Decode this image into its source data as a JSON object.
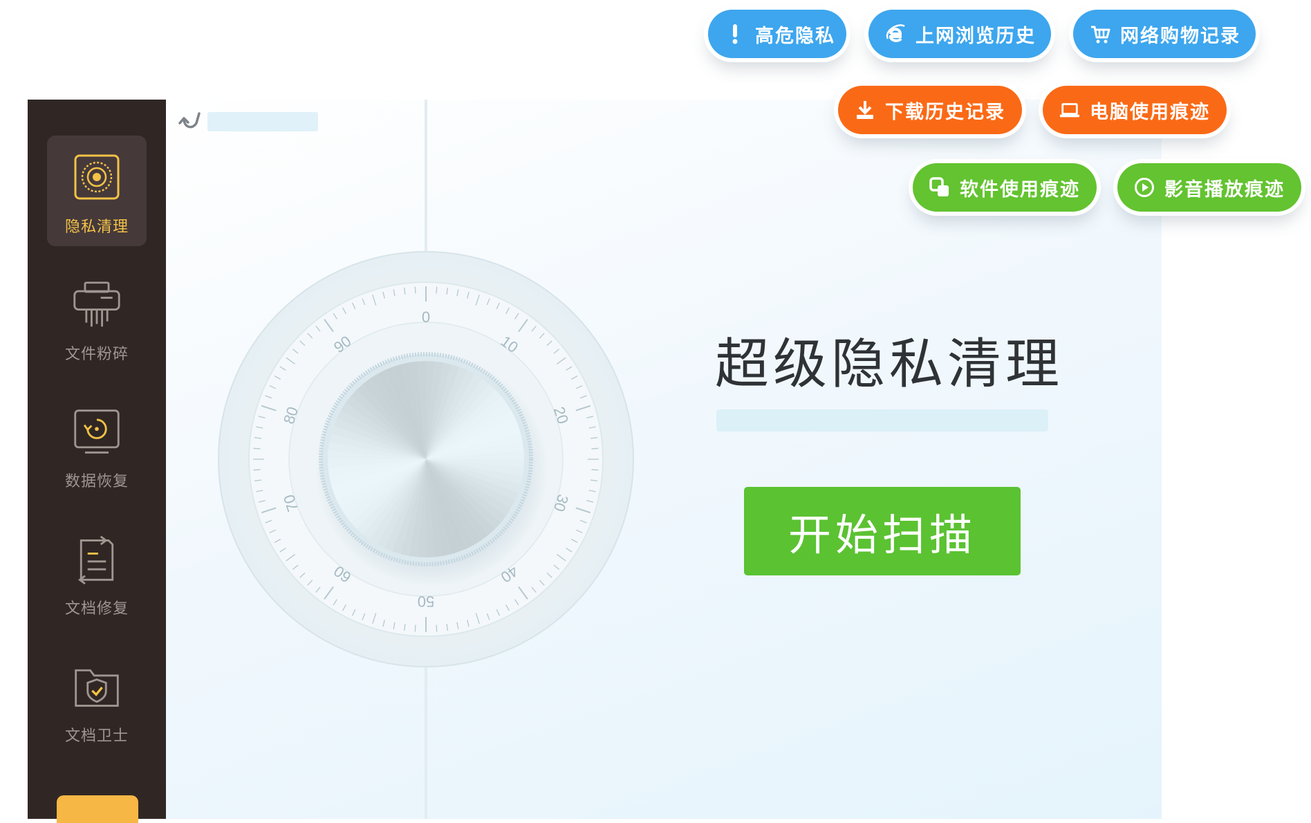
{
  "sidebar": {
    "items": [
      {
        "label": "隐私清理",
        "icon": "privacy-clean-icon",
        "active": true
      },
      {
        "label": "文件粉碎",
        "icon": "file-shredder-icon",
        "active": false
      },
      {
        "label": "数据恢复",
        "icon": "data-recovery-icon",
        "active": false
      },
      {
        "label": "文档修复",
        "icon": "document-repair-icon",
        "active": false
      },
      {
        "label": "文档卫士",
        "icon": "document-guard-icon",
        "active": false
      }
    ],
    "colors": {
      "background": "#302725",
      "active_item": "#45393a",
      "active_label": "#f3c247",
      "label": "#a09590",
      "accent": "#f7b745"
    }
  },
  "main": {
    "title": "超级隐私清理",
    "scan_button_label": "开始扫描",
    "scan_button_color": "#5bc232"
  },
  "dial": {
    "tick_labels": [
      "0",
      "10",
      "20",
      "30",
      "40",
      "50",
      "60",
      "70",
      "80",
      "90"
    ]
  },
  "categories": [
    {
      "label": "高危隐私",
      "color": "#3da6ee",
      "icon": "exclamation-icon"
    },
    {
      "label": "上网浏览历史",
      "color": "#3da6ee",
      "icon": "ie-browser-icon"
    },
    {
      "label": "网络购物记录",
      "color": "#3da6ee",
      "icon": "shopping-cart-icon"
    },
    {
      "label": "下载历史记录",
      "color": "#fa6a16",
      "icon": "download-icon"
    },
    {
      "label": "电脑使用痕迹",
      "color": "#fa6a16",
      "icon": "laptop-icon"
    },
    {
      "label": "软件使用痕迹",
      "color": "#63c330",
      "icon": "app-windows-icon"
    },
    {
      "label": "影音播放痕迹",
      "color": "#63c330",
      "icon": "play-icon"
    }
  ]
}
